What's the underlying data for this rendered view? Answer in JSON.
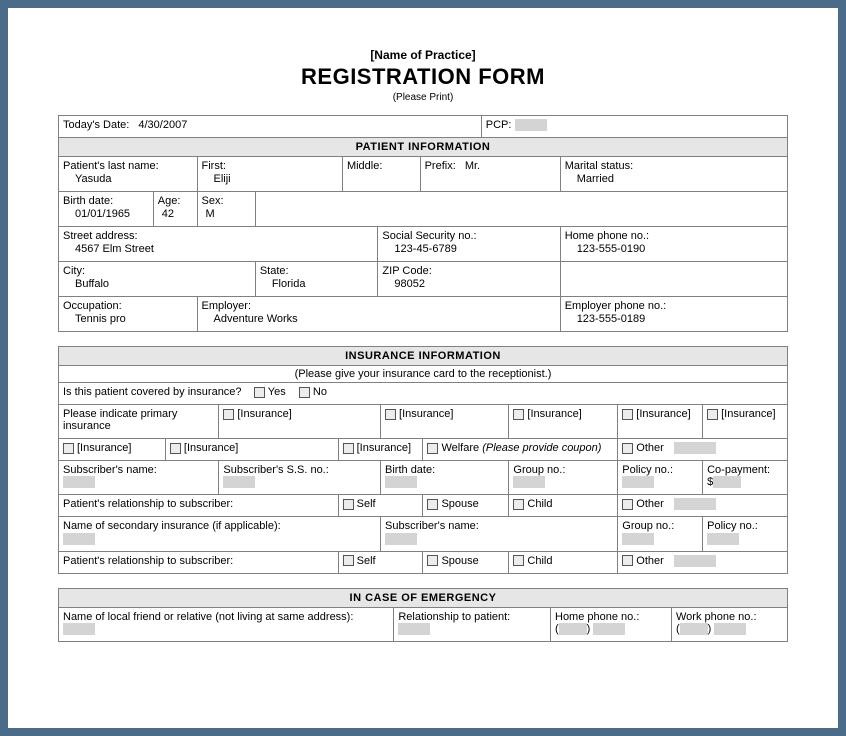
{
  "header": {
    "practice": "[Name of Practice]",
    "title": "REGISTRATION FORM",
    "subtitle": "(Please Print)"
  },
  "top": {
    "today_label": "Today's Date:",
    "today_value": "4/30/2007",
    "pcp_label": "PCP:"
  },
  "patient_section": {
    "heading": "PATIENT INFORMATION",
    "last_name_label": "Patient's last name:",
    "last_name": "Yasuda",
    "first_label": "First:",
    "first": "Eliji",
    "middle_label": "Middle:",
    "prefix_label": "Prefix:",
    "prefix": "Mr.",
    "marital_label": "Marital status:",
    "marital": "Married",
    "birth_label": "Birth date:",
    "birth": "01/01/1965",
    "age_label": "Age:",
    "age": "42",
    "sex_label": "Sex:",
    "sex": "M",
    "street_label": "Street address:",
    "street": "4567 Elm Street",
    "ssn_label": "Social Security no.:",
    "ssn": "123-45-6789",
    "home_phone_label": "Home phone no.:",
    "home_phone": "123-555-0190",
    "city_label": "City:",
    "city": "Buffalo",
    "state_label": "State:",
    "state": "Florida",
    "zip_label": "ZIP Code:",
    "zip": "98052",
    "occupation_label": "Occupation:",
    "occupation": "Tennis pro",
    "employer_label": "Employer:",
    "employer": "Adventure Works",
    "employer_phone_label": "Employer phone no.:",
    "employer_phone": "123-555-0189"
  },
  "insurance_section": {
    "heading": "INSURANCE INFORMATION",
    "instruction": "(Please give your insurance card to the receptionist.)",
    "covered_q": "Is this patient covered by insurance?",
    "yes": "Yes",
    "no": "No",
    "primary_label": "Please indicate primary insurance",
    "insurance_opt": "[Insurance]",
    "welfare": "Welfare",
    "welfare_note": "(Please provide coupon)",
    "other": "Other",
    "sub_name_label": "Subscriber's name:",
    "sub_ssn_label": "Subscriber's S.S. no.:",
    "birth_label": "Birth date:",
    "group_label": "Group no.:",
    "policy_label": "Policy no.:",
    "copay_label": "Co-payment:",
    "copay_prefix": "$",
    "rel_label": "Patient's relationship to subscriber:",
    "self": "Self",
    "spouse": "Spouse",
    "child": "Child",
    "secondary_label": "Name of secondary insurance (if applicable):",
    "rel_label2": "Patient's relationship to subscriber:"
  },
  "emergency_section": {
    "heading": "IN CASE OF EMERGENCY",
    "friend_label": "Name of local friend or relative (not living at same address):",
    "rel_label": "Relationship to patient:",
    "home_phone_label": "Home phone no.:",
    "work_phone_label": "Work phone no.:"
  }
}
